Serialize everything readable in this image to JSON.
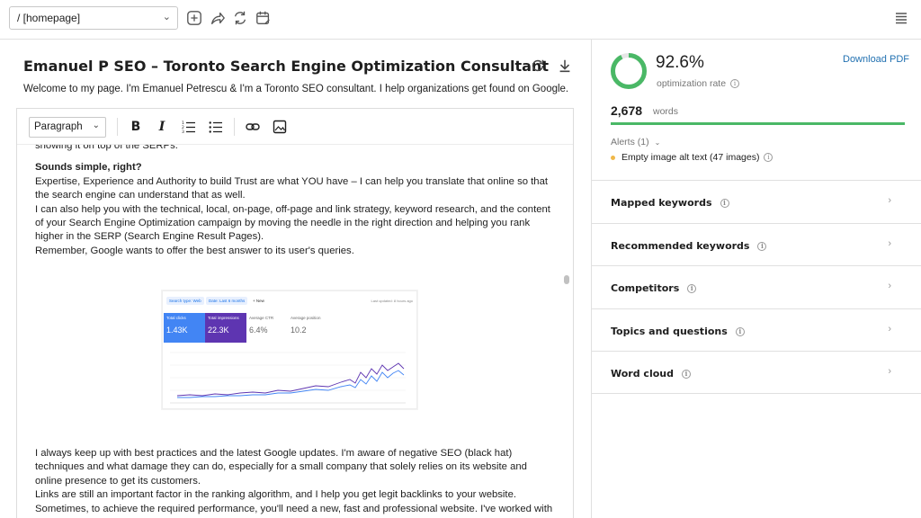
{
  "toolbar": {
    "page_selector": "/ [homepage]",
    "icons": [
      "plus-circle-icon",
      "share-arrow-icon",
      "refresh-icon",
      "calendar-edit-icon",
      "menu-icon"
    ]
  },
  "editor": {
    "title": "Emanuel P SEO – Toronto Search Engine Optimization Consultant",
    "description": "Welcome to my page. I'm Emanuel Petrescu & I'm a Toronto SEO consultant. I help organizations get found on Google.",
    "format_select": "Paragraph",
    "paragraphs_top": {
      "p0": "showing it on top of the SERPs.",
      "heading": "Sounds simple, right?",
      "p1": "Expertise, Experience and Authority to build Trust are what YOU have – I can help you translate that online so that the search engine can understand that as well.",
      "p2": "I can also help you with the technical, local, on-page, off-page and link strategy, keyword research, and the content of your Search Engine Optimization campaign by moving the needle in the right direction and helping you rank higher in the SERP (Search Engine Result Pages).",
      "p3": "Remember, Google wants to offer the best answer to its user's queries."
    },
    "paragraphs_bottom": {
      "p4": "I always keep up with best practices and the latest Google updates. I'm aware of negative SEO (black hat) techniques and what damage they can do, especially for a small company that solely relies on its website and online presence to get its customers.",
      "p5": "Links are still an important factor in the ranking algorithm, and I help you get legit backlinks to your website.",
      "p6": "Sometimes, to achieve the required performance, you'll need a new, fast and professional website. I've worked with"
    },
    "gsc": {
      "chip1": "Search type: Web",
      "chip2": "Date: Last 6 months",
      "new_label": "+ New",
      "updated": "Last updated: 8 hours ago",
      "tiles": [
        {
          "label": "Total clicks",
          "value": "1.43K",
          "color": "#4285f4"
        },
        {
          "label": "Total impressions",
          "value": "22.3K",
          "color": "#5e35b1"
        },
        {
          "label": "Average CTR",
          "value": "6.4%",
          "color": "#ffffff"
        },
        {
          "label": "Average position",
          "value": "10.2",
          "color": "#ffffff"
        }
      ]
    }
  },
  "sidebar": {
    "optimization_rate": "92.6%",
    "optimization_fraction": 0.926,
    "optimization_label": "optimization rate",
    "download_pdf": "Download PDF",
    "word_count": "2,678",
    "words_label": "words",
    "alerts_header": "Alerts (1)",
    "alert_item": "Empty image alt text (47 images)",
    "panels": [
      {
        "label": "Mapped keywords"
      },
      {
        "label": "Recommended keywords"
      },
      {
        "label": "Competitors"
      },
      {
        "label": "Topics and questions"
      },
      {
        "label": "Word cloud"
      }
    ],
    "accent_color": "#4ab866"
  }
}
